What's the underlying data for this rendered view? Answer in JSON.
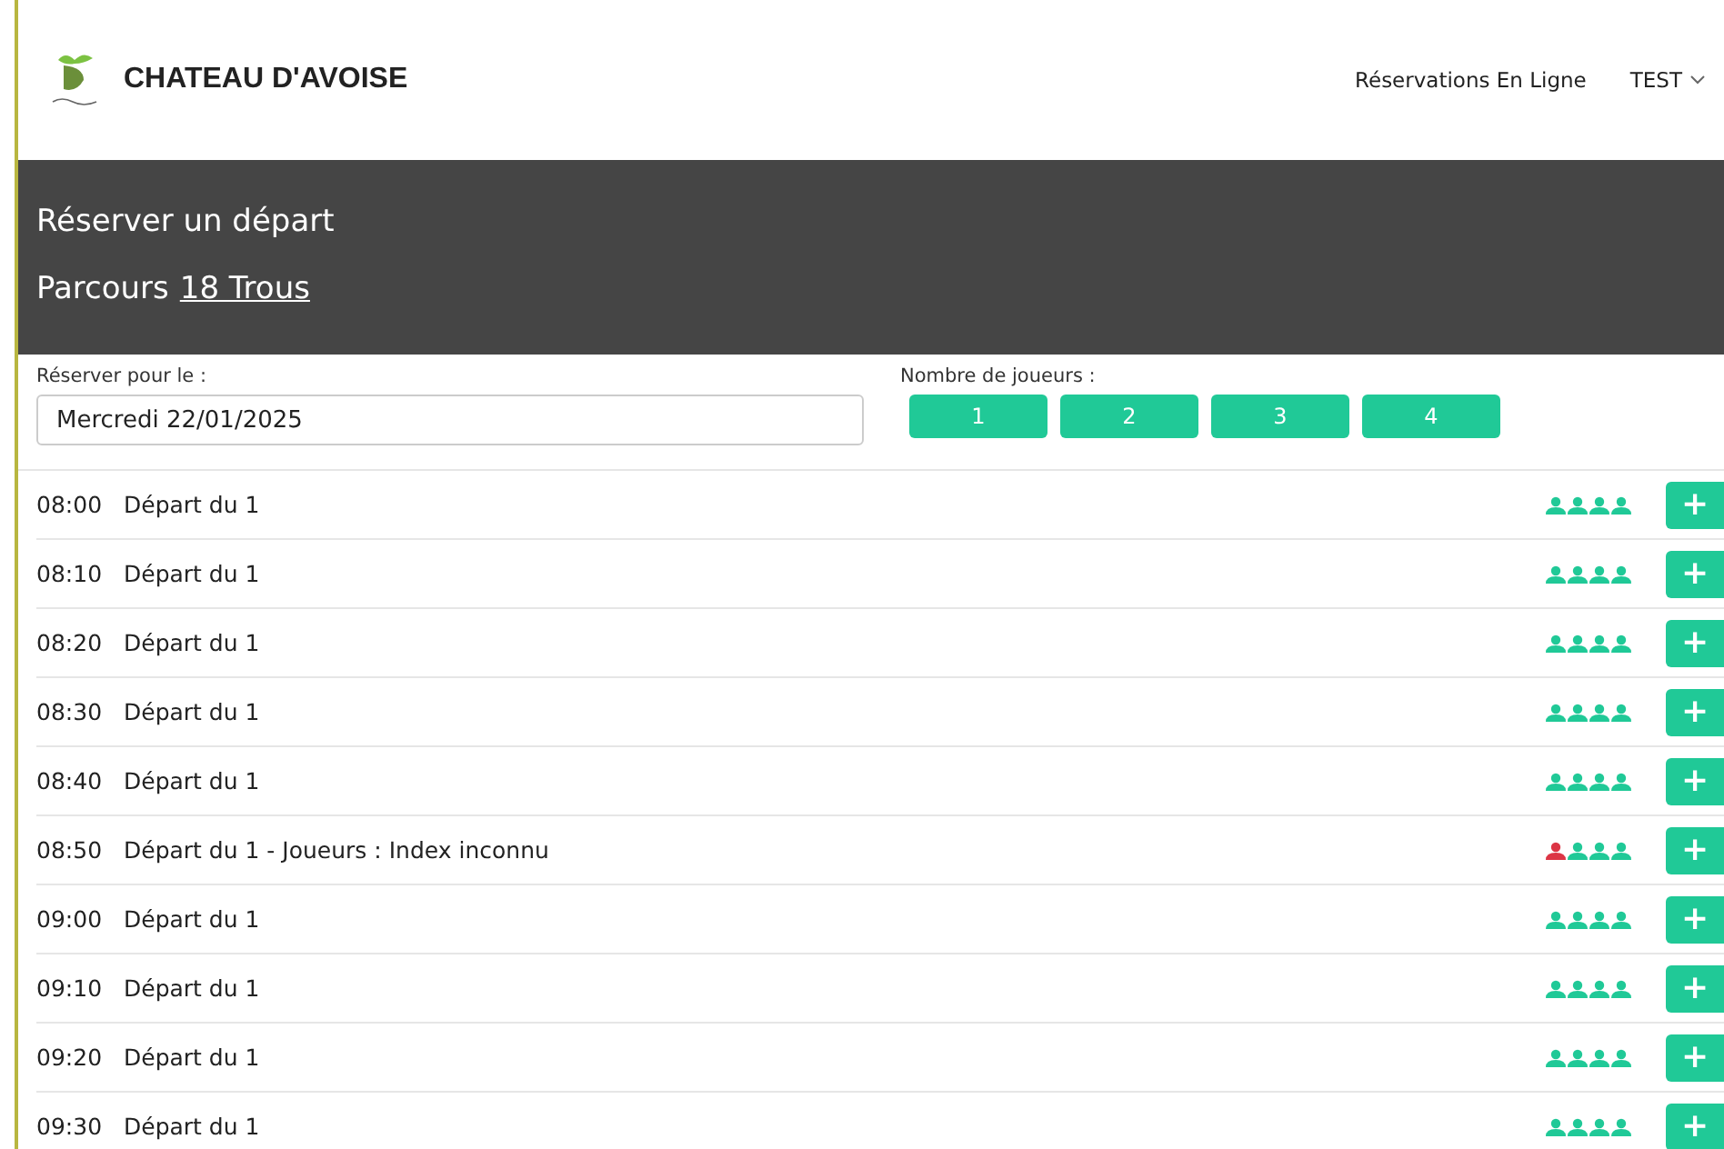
{
  "header": {
    "brand": "CHATEAU D'AVOISE",
    "nav_link": "Réservations En Ligne",
    "user_menu": "TEST"
  },
  "banner": {
    "title": "Réserver un départ",
    "course_prefix": "Parcours",
    "course_link": "18 Trous"
  },
  "form": {
    "date_label": "Réserver pour le :",
    "date_value": "Mercredi 22/01/2025",
    "players_label": "Nombre de joueurs :",
    "player_buttons": [
      "1",
      "2",
      "3",
      "4"
    ]
  },
  "slots": [
    {
      "time": "08:00",
      "label": "Départ du 1",
      "players": [
        {
          "color": "#20c997"
        },
        {
          "color": "#20c997"
        },
        {
          "color": "#20c997"
        },
        {
          "color": "#20c997"
        }
      ],
      "action": "+"
    },
    {
      "time": "08:10",
      "label": "Départ du 1",
      "players": [
        {
          "color": "#20c997"
        },
        {
          "color": "#20c997"
        },
        {
          "color": "#20c997"
        },
        {
          "color": "#20c997"
        }
      ],
      "action": "+"
    },
    {
      "time": "08:20",
      "label": "Départ du 1",
      "players": [
        {
          "color": "#20c997"
        },
        {
          "color": "#20c997"
        },
        {
          "color": "#20c997"
        },
        {
          "color": "#20c997"
        }
      ],
      "action": "+"
    },
    {
      "time": "08:30",
      "label": "Départ du 1",
      "players": [
        {
          "color": "#20c997"
        },
        {
          "color": "#20c997"
        },
        {
          "color": "#20c997"
        },
        {
          "color": "#20c997"
        }
      ],
      "action": "+"
    },
    {
      "time": "08:40",
      "label": "Départ du 1",
      "players": [
        {
          "color": "#20c997"
        },
        {
          "color": "#20c997"
        },
        {
          "color": "#20c997"
        },
        {
          "color": "#20c997"
        }
      ],
      "action": "+"
    },
    {
      "time": "08:50",
      "label": "Départ du 1 - Joueurs : Index inconnu",
      "players": [
        {
          "color": "#dc3545"
        },
        {
          "color": "#20c997"
        },
        {
          "color": "#20c997"
        },
        {
          "color": "#20c997"
        }
      ],
      "action": "+"
    },
    {
      "time": "09:00",
      "label": "Départ du 1",
      "players": [
        {
          "color": "#20c997"
        },
        {
          "color": "#20c997"
        },
        {
          "color": "#20c997"
        },
        {
          "color": "#20c997"
        }
      ],
      "action": "+"
    },
    {
      "time": "09:10",
      "label": "Départ du 1",
      "players": [
        {
          "color": "#20c997"
        },
        {
          "color": "#20c997"
        },
        {
          "color": "#20c997"
        },
        {
          "color": "#20c997"
        }
      ],
      "action": "+"
    },
    {
      "time": "09:20",
      "label": "Départ du 1",
      "players": [
        {
          "color": "#20c997"
        },
        {
          "color": "#20c997"
        },
        {
          "color": "#20c997"
        },
        {
          "color": "#20c997"
        }
      ],
      "action": "+"
    },
    {
      "time": "09:30",
      "label": "Départ du 1",
      "players": [
        {
          "color": "#20c997"
        },
        {
          "color": "#20c997"
        },
        {
          "color": "#20c997"
        },
        {
          "color": "#20c997"
        }
      ],
      "action": "+"
    }
  ]
}
